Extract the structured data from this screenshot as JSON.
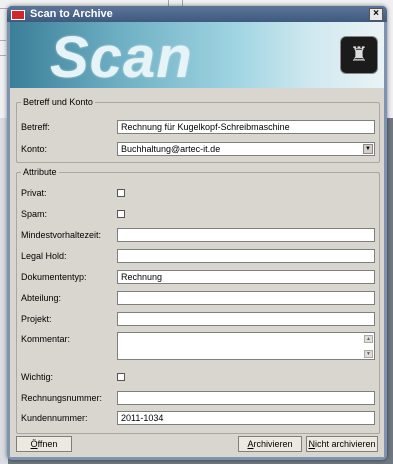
{
  "dialog": {
    "title": "Scan to Archive",
    "close_glyph": "×",
    "banner_text": "Scan",
    "banner_logo_icon": "scanner-logo-icon"
  },
  "account_group": {
    "title": "Betreff und Konto",
    "subject_label": "Betreff:",
    "subject_value": "Rechnung für Kugelkopf-Schreibmaschine",
    "account_label": "Konto:",
    "account_value": "Buchhaltung@artec-it.de"
  },
  "attributes_group": {
    "title": "Attribute",
    "private_label": "Privat:",
    "spam_label": "Spam:",
    "retention_label": "Mindestvorhaltezeit:",
    "retention_value": "",
    "legal_hold_label": "Legal Hold:",
    "legal_hold_value": "",
    "doctype_label": "Dokumententyp:",
    "doctype_value": "Rechnung",
    "department_label": "Abteilung:",
    "department_value": "",
    "project_label": "Projekt:",
    "project_value": "",
    "comment_label": "Kommentar:",
    "comment_value": "",
    "important_label": "Wichtig:",
    "invoice_no_label": "Rechnungsnummer:",
    "invoice_no_value": "",
    "customer_no_label": "Kundennummer:",
    "customer_no_value": "2011-1034"
  },
  "buttons": {
    "open_u": "Ö",
    "open_rest": "ffnen",
    "archive_u": "A",
    "archive_rest": "rchivieren",
    "no_archive_u": "N",
    "no_archive_rest": "icht archivieren"
  },
  "colors": {
    "title_bar": "#3f5a7f",
    "dialog_frame": "#7d93b0",
    "client_bg": "#d8d6cf"
  }
}
